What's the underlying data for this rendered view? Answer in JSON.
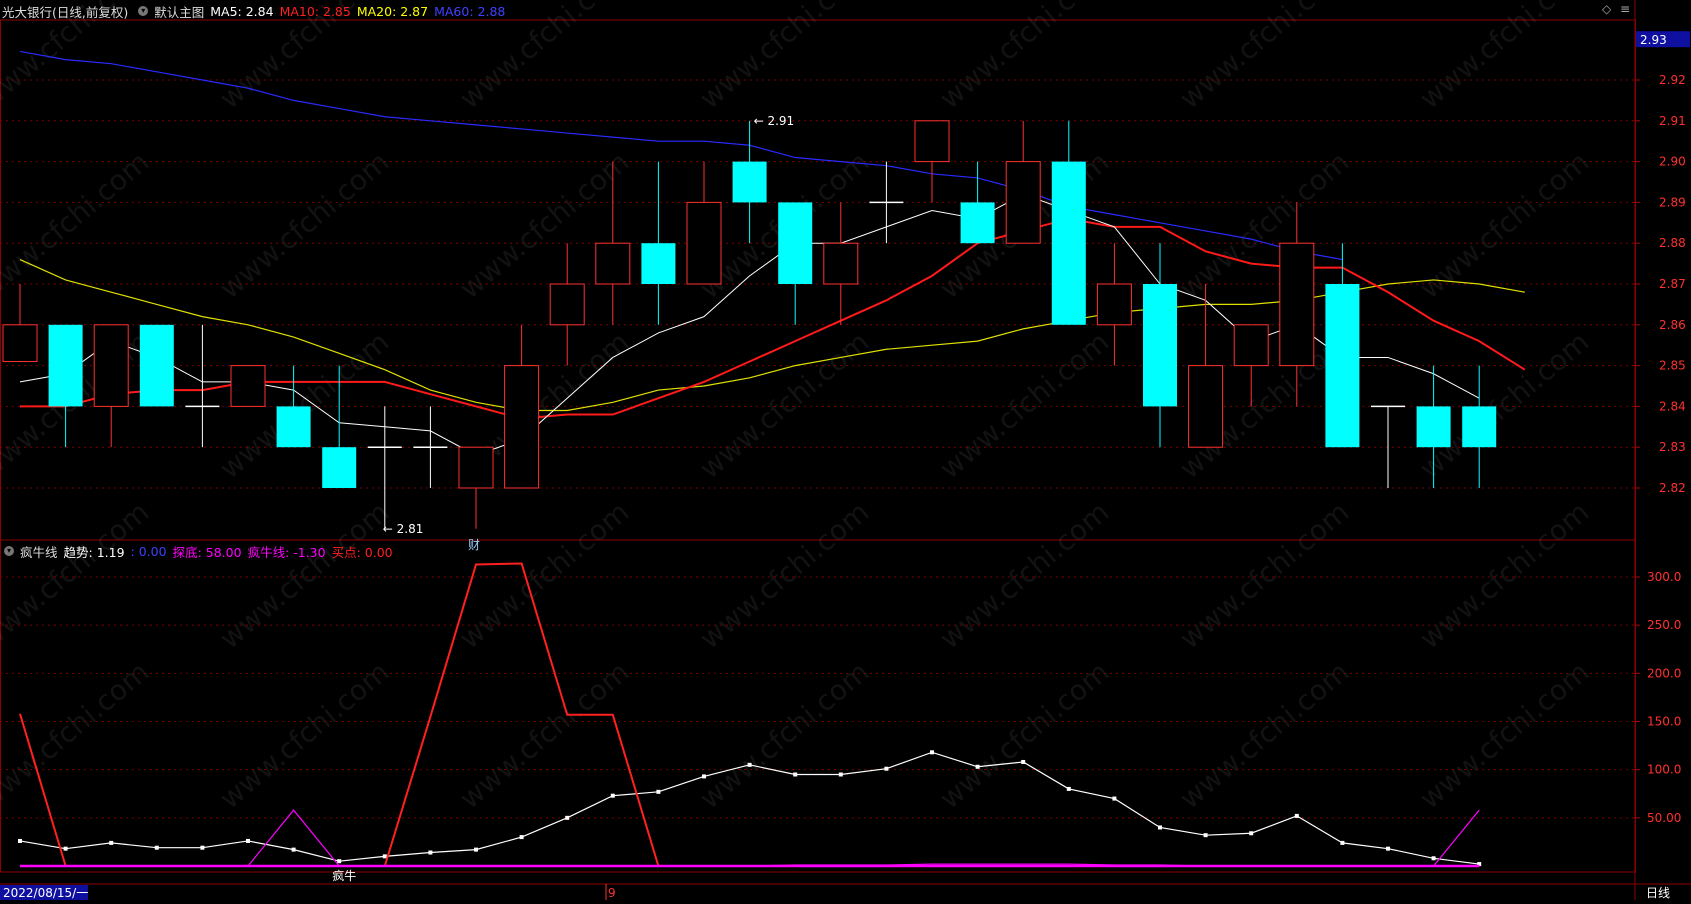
{
  "top_legend": {
    "stock": "光大银行(日线,前复权)",
    "indicator": "默认主图",
    "ma5": "MA5: 2.84",
    "ma10": "MA10: 2.85",
    "ma20": "MA20: 2.87",
    "ma60": "MA60: 2.88",
    "colors": {
      "ma5": "#ffffff",
      "ma10": "#ff2020",
      "ma20": "#ffff00",
      "ma60": "#3030ff"
    }
  },
  "bottom_legend": {
    "indicator": "疯牛线",
    "trend": "趋势: 1.19",
    "blank": ": 0.00",
    "probe": "探底: 58.00",
    "bull": "疯牛线: -1.30",
    "buy": "买点: 0.00",
    "colors": {
      "trend": "#ffffff",
      "blank": "#3030ff",
      "probe": "#ff00ff",
      "bull": "#ff00ff",
      "buy": "#ff2020"
    }
  },
  "date_label": "2022/08/15/一",
  "month_marker": "9",
  "period_label": "日线",
  "price_current": "2.93",
  "annotations": {
    "high": "2.91",
    "low": "2.81",
    "cai": "财",
    "fengniu": "疯牛"
  },
  "watermark": "www.cfchi.com",
  "chart_data": [
    {
      "type": "candlestick",
      "y_ticks": [
        "2.92",
        "2.91",
        "2.90",
        "2.89",
        "2.88",
        "2.87",
        "2.86",
        "2.85",
        "2.84",
        "2.83",
        "2.82"
      ],
      "ylim": [
        2.81,
        2.93
      ],
      "candles": [
        {
          "o": 2.851,
          "c": 2.86,
          "h": 2.87,
          "l": 2.851
        },
        {
          "o": 2.86,
          "c": 2.84,
          "h": 2.86,
          "l": 2.83
        },
        {
          "o": 2.84,
          "c": 2.86,
          "h": 2.86,
          "l": 2.83
        },
        {
          "o": 2.86,
          "c": 2.84,
          "h": 2.86,
          "l": 2.84
        },
        {
          "o": 2.84,
          "c": 2.84,
          "h": 2.86,
          "l": 2.83
        },
        {
          "o": 2.84,
          "c": 2.85,
          "h": 2.85,
          "l": 2.84
        },
        {
          "o": 2.84,
          "c": 2.83,
          "h": 2.85,
          "l": 2.83
        },
        {
          "o": 2.83,
          "c": 2.82,
          "h": 2.85,
          "l": 2.82
        },
        {
          "o": 2.83,
          "c": 2.83,
          "h": 2.84,
          "l": 2.81
        },
        {
          "o": 2.83,
          "c": 2.83,
          "h": 2.84,
          "l": 2.82
        },
        {
          "o": 2.82,
          "c": 2.83,
          "h": 2.83,
          "l": 2.81
        },
        {
          "o": 2.82,
          "c": 2.85,
          "h": 2.86,
          "l": 2.82
        },
        {
          "o": 2.86,
          "c": 2.87,
          "h": 2.88,
          "l": 2.85
        },
        {
          "o": 2.87,
          "c": 2.88,
          "h": 2.9,
          "l": 2.86
        },
        {
          "o": 2.88,
          "c": 2.87,
          "h": 2.9,
          "l": 2.86
        },
        {
          "o": 2.87,
          "c": 2.89,
          "h": 2.9,
          "l": 2.87
        },
        {
          "o": 2.9,
          "c": 2.89,
          "h": 2.91,
          "l": 2.88
        },
        {
          "o": 2.89,
          "c": 2.87,
          "h": 2.89,
          "l": 2.86
        },
        {
          "o": 2.87,
          "c": 2.88,
          "h": 2.89,
          "l": 2.86
        },
        {
          "o": 2.89,
          "c": 2.89,
          "h": 2.9,
          "l": 2.88
        },
        {
          "o": 2.9,
          "c": 2.91,
          "h": 2.91,
          "l": 2.89
        },
        {
          "o": 2.89,
          "c": 2.88,
          "h": 2.9,
          "l": 2.88
        },
        {
          "o": 2.88,
          "c": 2.9,
          "h": 2.91,
          "l": 2.88
        },
        {
          "o": 2.9,
          "c": 2.86,
          "h": 2.91,
          "l": 2.86
        },
        {
          "o": 2.86,
          "c": 2.87,
          "h": 2.88,
          "l": 2.85
        },
        {
          "o": 2.87,
          "c": 2.84,
          "h": 2.88,
          "l": 2.83
        },
        {
          "o": 2.83,
          "c": 2.85,
          "h": 2.87,
          "l": 2.83
        },
        {
          "o": 2.85,
          "c": 2.86,
          "h": 2.86,
          "l": 2.84
        },
        {
          "o": 2.85,
          "c": 2.88,
          "h": 2.89,
          "l": 2.84
        },
        {
          "o": 2.87,
          "c": 2.83,
          "h": 2.88,
          "l": 2.83
        },
        {
          "o": 2.84,
          "c": 2.84,
          "h": 2.84,
          "l": 2.82
        },
        {
          "o": 2.84,
          "c": 2.83,
          "h": 2.85,
          "l": 2.82
        },
        {
          "o": 2.84,
          "c": 2.83,
          "h": 2.85,
          "l": 2.82
        }
      ],
      "ma5": [
        2.846,
        2.848,
        2.856,
        2.852,
        2.846,
        2.846,
        2.844,
        2.836,
        2.835,
        2.834,
        2.828,
        2.832,
        2.842,
        2.852,
        2.858,
        2.862,
        2.872,
        2.88,
        2.88,
        2.884,
        2.888,
        2.886,
        2.892,
        2.888,
        2.884,
        2.87,
        2.866,
        2.856,
        2.86,
        2.852,
        2.852,
        2.848,
        2.842
      ],
      "ma10": [
        2.84,
        2.84,
        2.843,
        2.844,
        2.844,
        2.846,
        2.846,
        2.846,
        2.846,
        2.843,
        2.84,
        2.837,
        2.838,
        2.838,
        2.842,
        2.846,
        2.851,
        2.856,
        2.861,
        2.866,
        2.872,
        2.88,
        2.883,
        2.886,
        2.884,
        2.884,
        2.878,
        2.875,
        2.874,
        2.874,
        2.868,
        2.861,
        2.856,
        2.849
      ],
      "ma20": [
        2.876,
        2.871,
        2.868,
        2.865,
        2.862,
        2.86,
        2.857,
        2.853,
        2.849,
        2.844,
        2.841,
        2.839,
        2.839,
        2.841,
        2.844,
        2.845,
        2.847,
        2.85,
        2.852,
        2.854,
        2.855,
        2.856,
        2.859,
        2.861,
        2.863,
        2.864,
        2.865,
        2.865,
        2.866,
        2.868,
        2.87,
        2.871,
        2.87,
        2.868
      ],
      "ma60": [
        2.927,
        2.925,
        2.924,
        2.922,
        2.92,
        2.918,
        2.915,
        2.913,
        2.911,
        2.91,
        2.909,
        2.908,
        2.907,
        2.906,
        2.905,
        2.905,
        2.904,
        2.901,
        2.9,
        2.899,
        2.897,
        2.896,
        2.893,
        2.889,
        2.887,
        2.885,
        2.883,
        2.881,
        2.878,
        2.876
      ],
      "ma10_start_index": 0,
      "ma60_start_index": 0
    },
    {
      "type": "line",
      "y_ticks": [
        "300.0",
        "250.0",
        "200.0",
        "150.0",
        "100.0",
        "50.00"
      ],
      "ylim": [
        0,
        330
      ],
      "series": [
        {
          "color": "#ffffff",
          "values": [
            26,
            18,
            24,
            19,
            19,
            26,
            17,
            5,
            10,
            14,
            17,
            30,
            50,
            73,
            77,
            93,
            105,
            95,
            95,
            101,
            118,
            103,
            108,
            80,
            70,
            40,
            32,
            34,
            52,
            24,
            18,
            8,
            2
          ]
        },
        {
          "color": "#ff2020",
          "values": [
            158,
            0,
            0,
            0,
            0,
            0,
            0,
            0,
            0,
            155,
            313,
            314,
            157,
            157,
            0,
            0,
            0,
            0,
            0,
            0,
            0,
            0,
            0,
            0,
            0,
            0,
            0,
            0,
            0,
            0,
            0,
            0,
            0
          ]
        },
        {
          "color": "#ff00ff",
          "values": [
            0,
            0,
            0,
            0,
            0,
            0,
            58,
            0,
            0,
            0,
            0,
            0,
            0,
            0,
            0,
            0,
            0,
            1,
            1,
            1,
            2,
            2,
            2,
            2,
            1,
            1,
            0,
            0,
            0,
            0,
            0,
            0,
            58
          ]
        },
        {
          "color": "#ff3399",
          "values": [
            0,
            0,
            0,
            0,
            0,
            0,
            0,
            0,
            0,
            0,
            0,
            0,
            0,
            0,
            0,
            0,
            0,
            0,
            0,
            0,
            0,
            0,
            0,
            0,
            0,
            0,
            0,
            0,
            0,
            0,
            0,
            0,
            0
          ]
        }
      ]
    }
  ]
}
